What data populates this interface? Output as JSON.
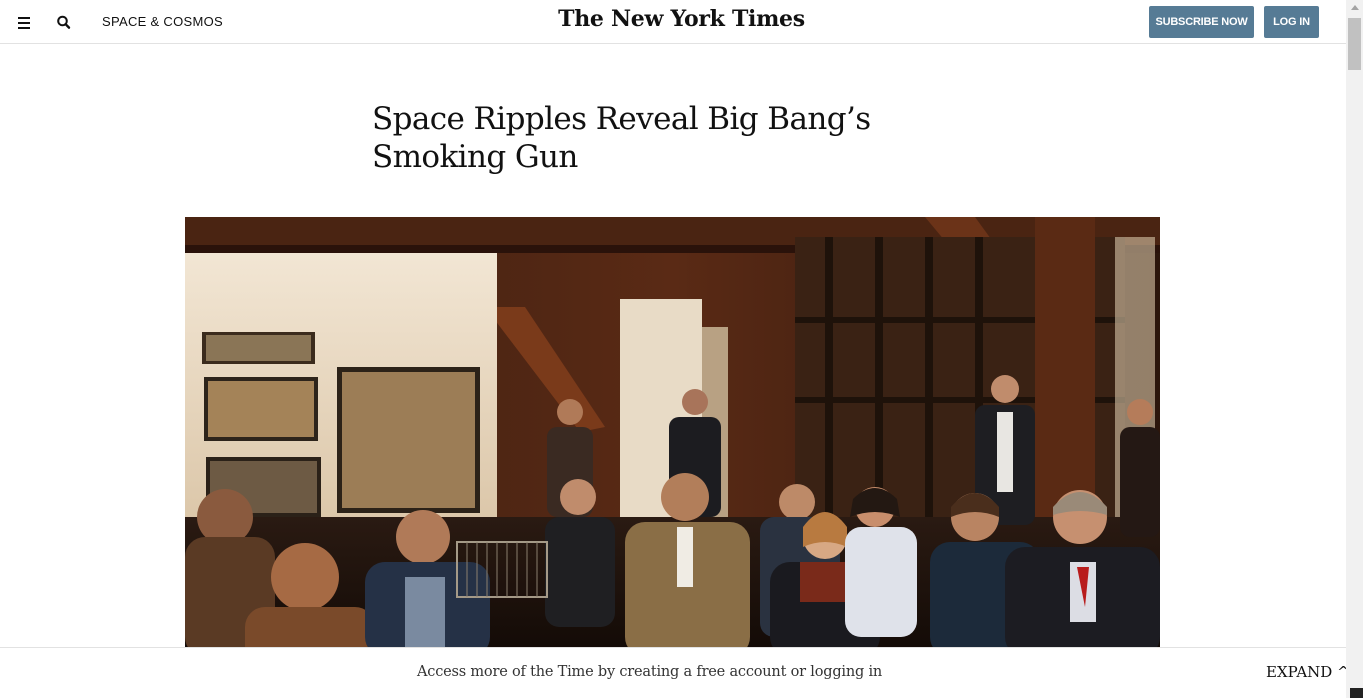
{
  "header": {
    "section": "SPACE & COSMOS",
    "masthead": "The New York Times",
    "subscribe_label": "SUBSCRIBE NOW",
    "login_label": "LOG IN",
    "menu_icon": "hamburger-menu-icon",
    "search_icon": "magnifier-search-icon",
    "button_color": "#567b95"
  },
  "article": {
    "headline": "Space Ripples Reveal Big Bang’s Smoking Gun"
  },
  "footer": {
    "access_text": "Access more of the Time by creating a free account or logging in",
    "expand_label": "EXPAND ^"
  }
}
